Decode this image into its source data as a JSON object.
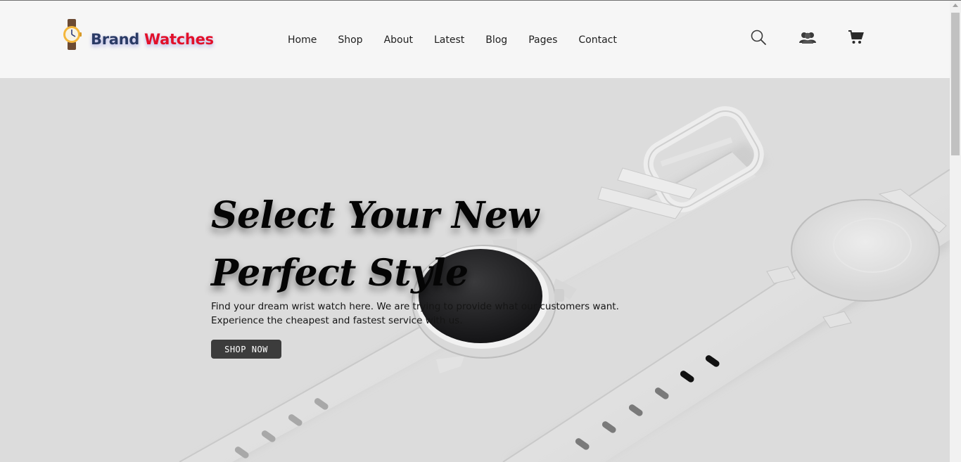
{
  "brand": {
    "name_part1": "Brand",
    "name_part2": "Watches",
    "color_part1": "#2b3b66",
    "color_part2": "#e2102a",
    "logo_icon": "wristwatch-icon"
  },
  "nav": {
    "items": [
      {
        "label": "Home"
      },
      {
        "label": "Shop"
      },
      {
        "label": "About"
      },
      {
        "label": "Latest"
      },
      {
        "label": "Blog"
      },
      {
        "label": "Pages"
      },
      {
        "label": "Contact"
      }
    ]
  },
  "header_icons": {
    "search": "search-icon",
    "account": "users-icon",
    "cart": "cart-icon"
  },
  "hero": {
    "title_line1": "Select Your New",
    "title_line2": "Perfect Style",
    "desc_line1": "Find your dream wrist watch here. We are trying to provide what our customers want.",
    "desc_line2": "Experience the cheapest and fastest service with us.",
    "button_label": "SHOP NOW",
    "background_color": "#dcdcdc",
    "button_color": "#3c3c3c"
  }
}
